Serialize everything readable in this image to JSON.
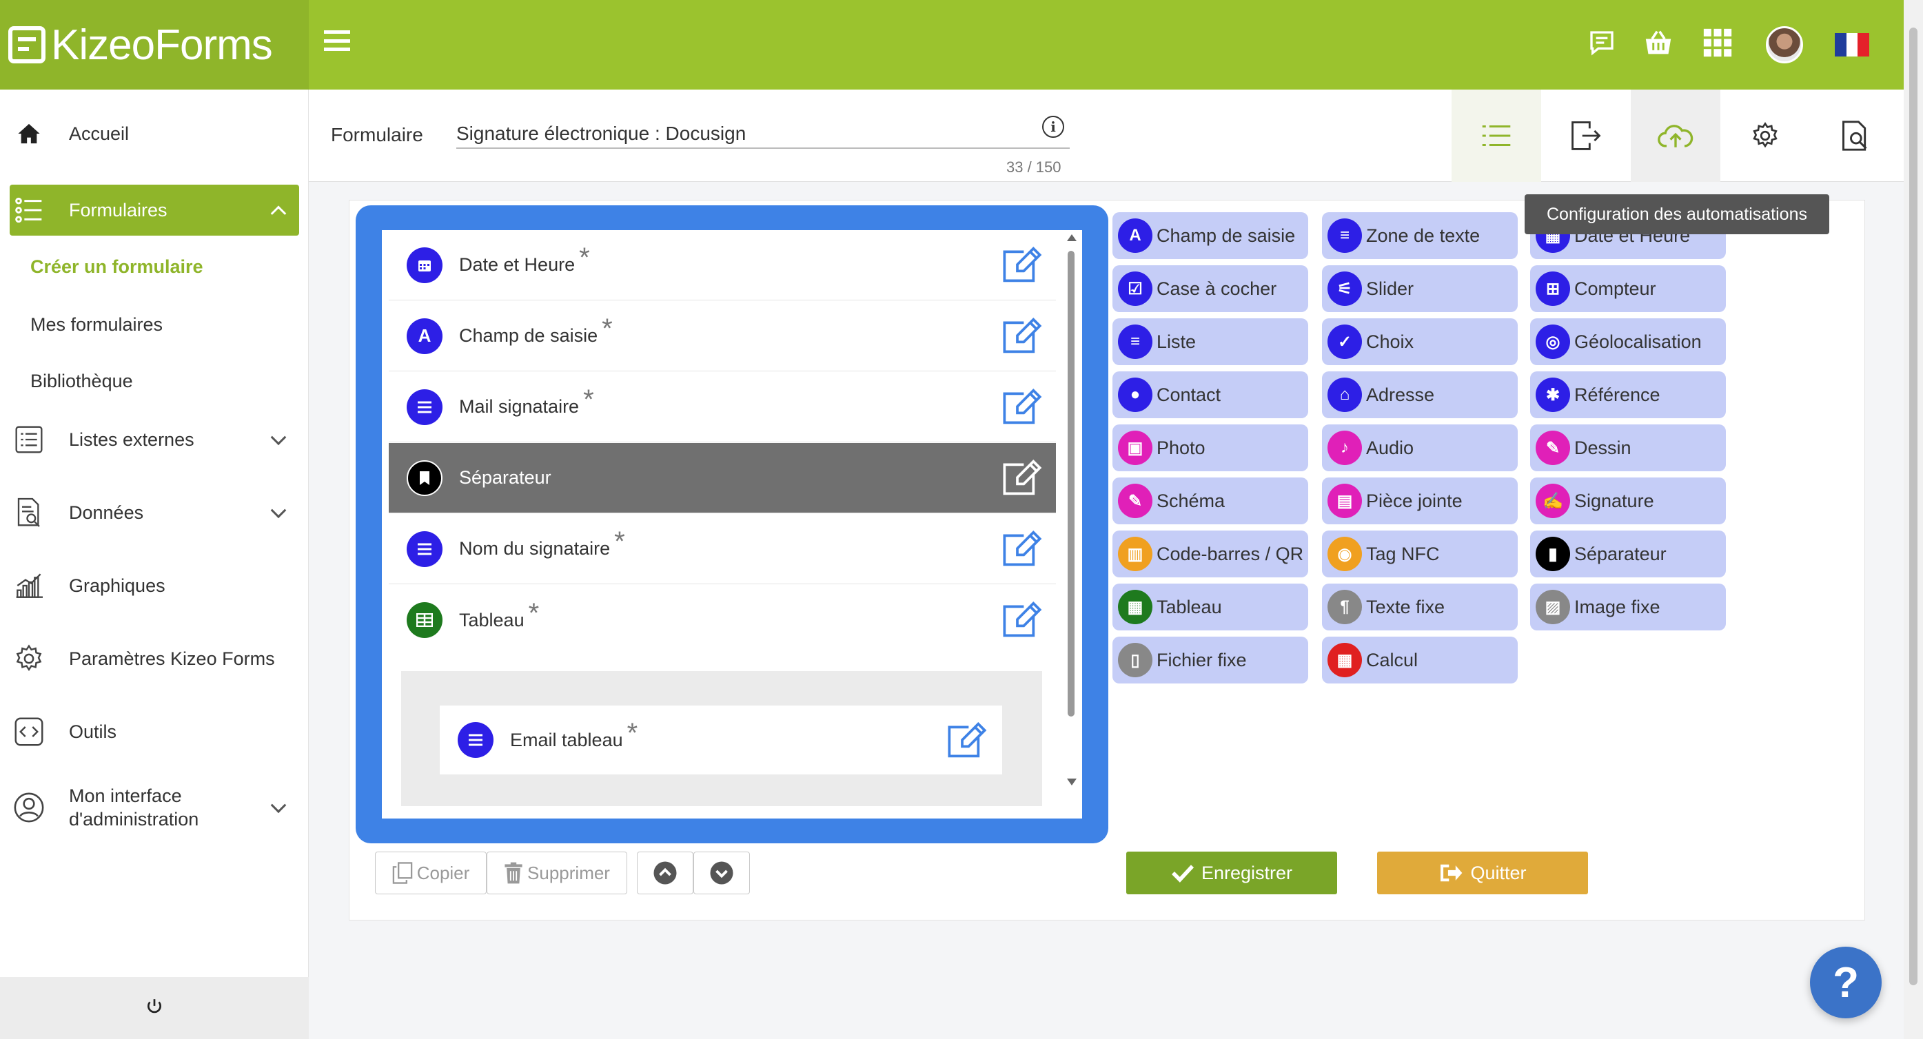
{
  "app": {
    "logo": "KizeoForms"
  },
  "topbar": {
    "icons": [
      "chat-icon",
      "basket-icon",
      "apps-grid-icon",
      "avatar",
      "french-flag"
    ]
  },
  "sidebar": {
    "items": [
      {
        "label": "Accueil",
        "icon": "home-icon"
      },
      {
        "label": "Formulaires",
        "icon": "list-icon",
        "expanded": true
      },
      {
        "label": "Listes externes",
        "icon": "list-box-icon"
      },
      {
        "label": "Données",
        "icon": "document-search-icon"
      },
      {
        "label": "Graphiques",
        "icon": "bar-chart-icon"
      },
      {
        "label": "Paramètres Kizeo Forms",
        "icon": "gear-icon"
      },
      {
        "label": "Outils",
        "icon": "code-icon"
      },
      {
        "label": "Mon interface\nd'administration",
        "icon": "user-circle-icon"
      }
    ],
    "sub_items": [
      "Créer un formulaire",
      "Mes formulaires",
      "Bibliothèque"
    ],
    "footer_icon": "power-icon"
  },
  "header": {
    "label": "Formulaire",
    "form_title": "Signature électronique : Docusign",
    "char_count": "33 / 150",
    "tabs": [
      "fields-list-tab",
      "export-tab",
      "automation-tab",
      "settings-tab",
      "preview-tab"
    ],
    "tooltip": "Configuration des automatisations"
  },
  "editor": {
    "fields": [
      {
        "label": "Date et Heure",
        "icon": "calendar-icon",
        "required": "*",
        "color": "#2d1fe6"
      },
      {
        "label": "Champ de saisie",
        "icon": "A",
        "required": "*",
        "color": "#2d1fe6"
      },
      {
        "label": "Mail signataire",
        "icon": "lines-icon",
        "required": "*",
        "color": "#2d1fe6"
      },
      {
        "label": "Séparateur",
        "icon": "bookmark-icon",
        "required": "",
        "color": "#000000",
        "selected": true
      },
      {
        "label": "Nom du signataire",
        "icon": "lines-icon",
        "required": "*",
        "color": "#2d1fe6"
      },
      {
        "label": "Tableau",
        "icon": "table-icon",
        "required": "*",
        "color": "#1e7a1e"
      }
    ],
    "subfield": {
      "label": "Email tableau",
      "icon": "lines-icon",
      "required": "*",
      "color": "#2d1fe6"
    }
  },
  "palette": [
    {
      "label": "Champ de saisie",
      "glyph": "A",
      "color": "#2d1fe6"
    },
    {
      "label": "Zone de texte",
      "glyph": "≡",
      "color": "#2d1fe6"
    },
    {
      "label": "Date et Heure",
      "glyph": "▦",
      "color": "#2d1fe6"
    },
    {
      "label": "Case à cocher",
      "glyph": "☑",
      "color": "#2d1fe6"
    },
    {
      "label": "Slider",
      "glyph": "⚟",
      "color": "#2d1fe6"
    },
    {
      "label": "Compteur",
      "glyph": "⊞",
      "color": "#2d1fe6"
    },
    {
      "label": "Liste",
      "glyph": "≡",
      "color": "#2d1fe6"
    },
    {
      "label": "Choix",
      "glyph": "✓",
      "color": "#2d1fe6"
    },
    {
      "label": "Géolocalisation",
      "glyph": "◎",
      "color": "#2d1fe6"
    },
    {
      "label": "Contact",
      "glyph": "●",
      "color": "#2d1fe6"
    },
    {
      "label": "Adresse",
      "glyph": "⌂",
      "color": "#2d1fe6"
    },
    {
      "label": "Référence",
      "glyph": "✱",
      "color": "#2d1fe6"
    },
    {
      "label": "Photo",
      "glyph": "▣",
      "color": "#e020b8"
    },
    {
      "label": "Audio",
      "glyph": "♪",
      "color": "#e020b8"
    },
    {
      "label": "Dessin",
      "glyph": "✎",
      "color": "#e020b8"
    },
    {
      "label": "Schéma",
      "glyph": "✎",
      "color": "#e020b8"
    },
    {
      "label": "Pièce jointe",
      "glyph": "▤",
      "color": "#e020b8"
    },
    {
      "label": "Signature",
      "glyph": "✍",
      "color": "#e020b8"
    },
    {
      "label": "Code-barres / QR Code",
      "glyph": "▥",
      "color": "#f0a020"
    },
    {
      "label": "Tag NFC",
      "glyph": "◉",
      "color": "#f0a020"
    },
    {
      "label": "Séparateur",
      "glyph": "▮",
      "color": "#000000"
    },
    {
      "label": "Tableau",
      "glyph": "▦",
      "color": "#1e7a1e"
    },
    {
      "label": "Texte fixe",
      "glyph": "¶",
      "color": "#888888"
    },
    {
      "label": "Image fixe",
      "glyph": "▨",
      "color": "#888888"
    },
    {
      "label": "Fichier fixe",
      "glyph": "▯",
      "color": "#888888"
    },
    {
      "label": "Calcul",
      "glyph": "▦",
      "color": "#e02020"
    }
  ],
  "actions": {
    "copy": "Copier",
    "delete": "Supprimer",
    "save": "Enregistrer",
    "quit": "Quitter"
  },
  "help": "?"
}
